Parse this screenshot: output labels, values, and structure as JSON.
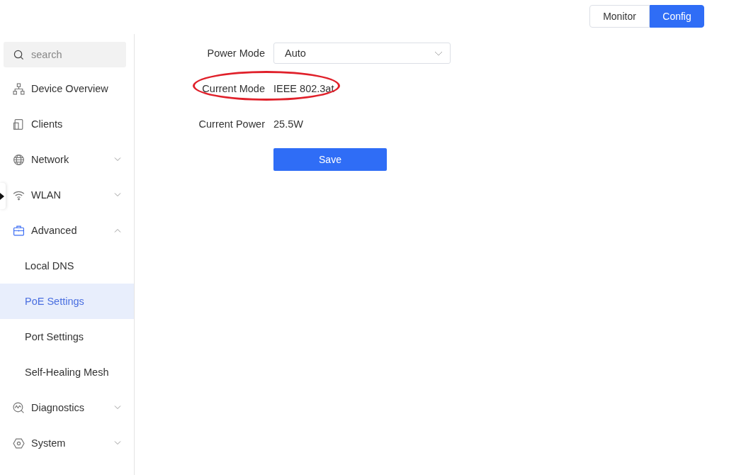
{
  "view_switch": [
    {
      "label": "Monitor",
      "selected": false
    },
    {
      "label": "Config",
      "selected": true
    }
  ],
  "sidebar": {
    "search": {
      "placeholder": "search"
    },
    "items": [
      {
        "label": "Device Overview",
        "selected": false
      },
      {
        "label": "Clients",
        "selected": false
      },
      {
        "label": "Network",
        "selected": false,
        "expanded": false
      },
      {
        "label": "WLAN",
        "selected": false,
        "expanded": false
      },
      {
        "label": "Advanced",
        "selected": false,
        "expanded": true,
        "children": [
          {
            "label": "Local DNS",
            "selected": false
          },
          {
            "label": "PoE Settings",
            "selected": true
          },
          {
            "label": "Port Settings",
            "selected": false
          },
          {
            "label": "Self-Healing Mesh",
            "selected": false
          }
        ]
      },
      {
        "label": "Diagnostics",
        "selected": false,
        "expanded": false
      },
      {
        "label": "System",
        "selected": false,
        "expanded": false
      }
    ]
  },
  "form": {
    "fields": [
      {
        "kind": "select",
        "label": "Power Mode",
        "value": "Auto",
        "highlighted": false
      },
      {
        "kind": "text",
        "label": "Current Mode",
        "value": "IEEE 802.3at",
        "highlighted": true
      },
      {
        "kind": "text",
        "label": "Current Power",
        "value": "25.5W",
        "highlighted": false
      }
    ],
    "save_button": "Save"
  }
}
